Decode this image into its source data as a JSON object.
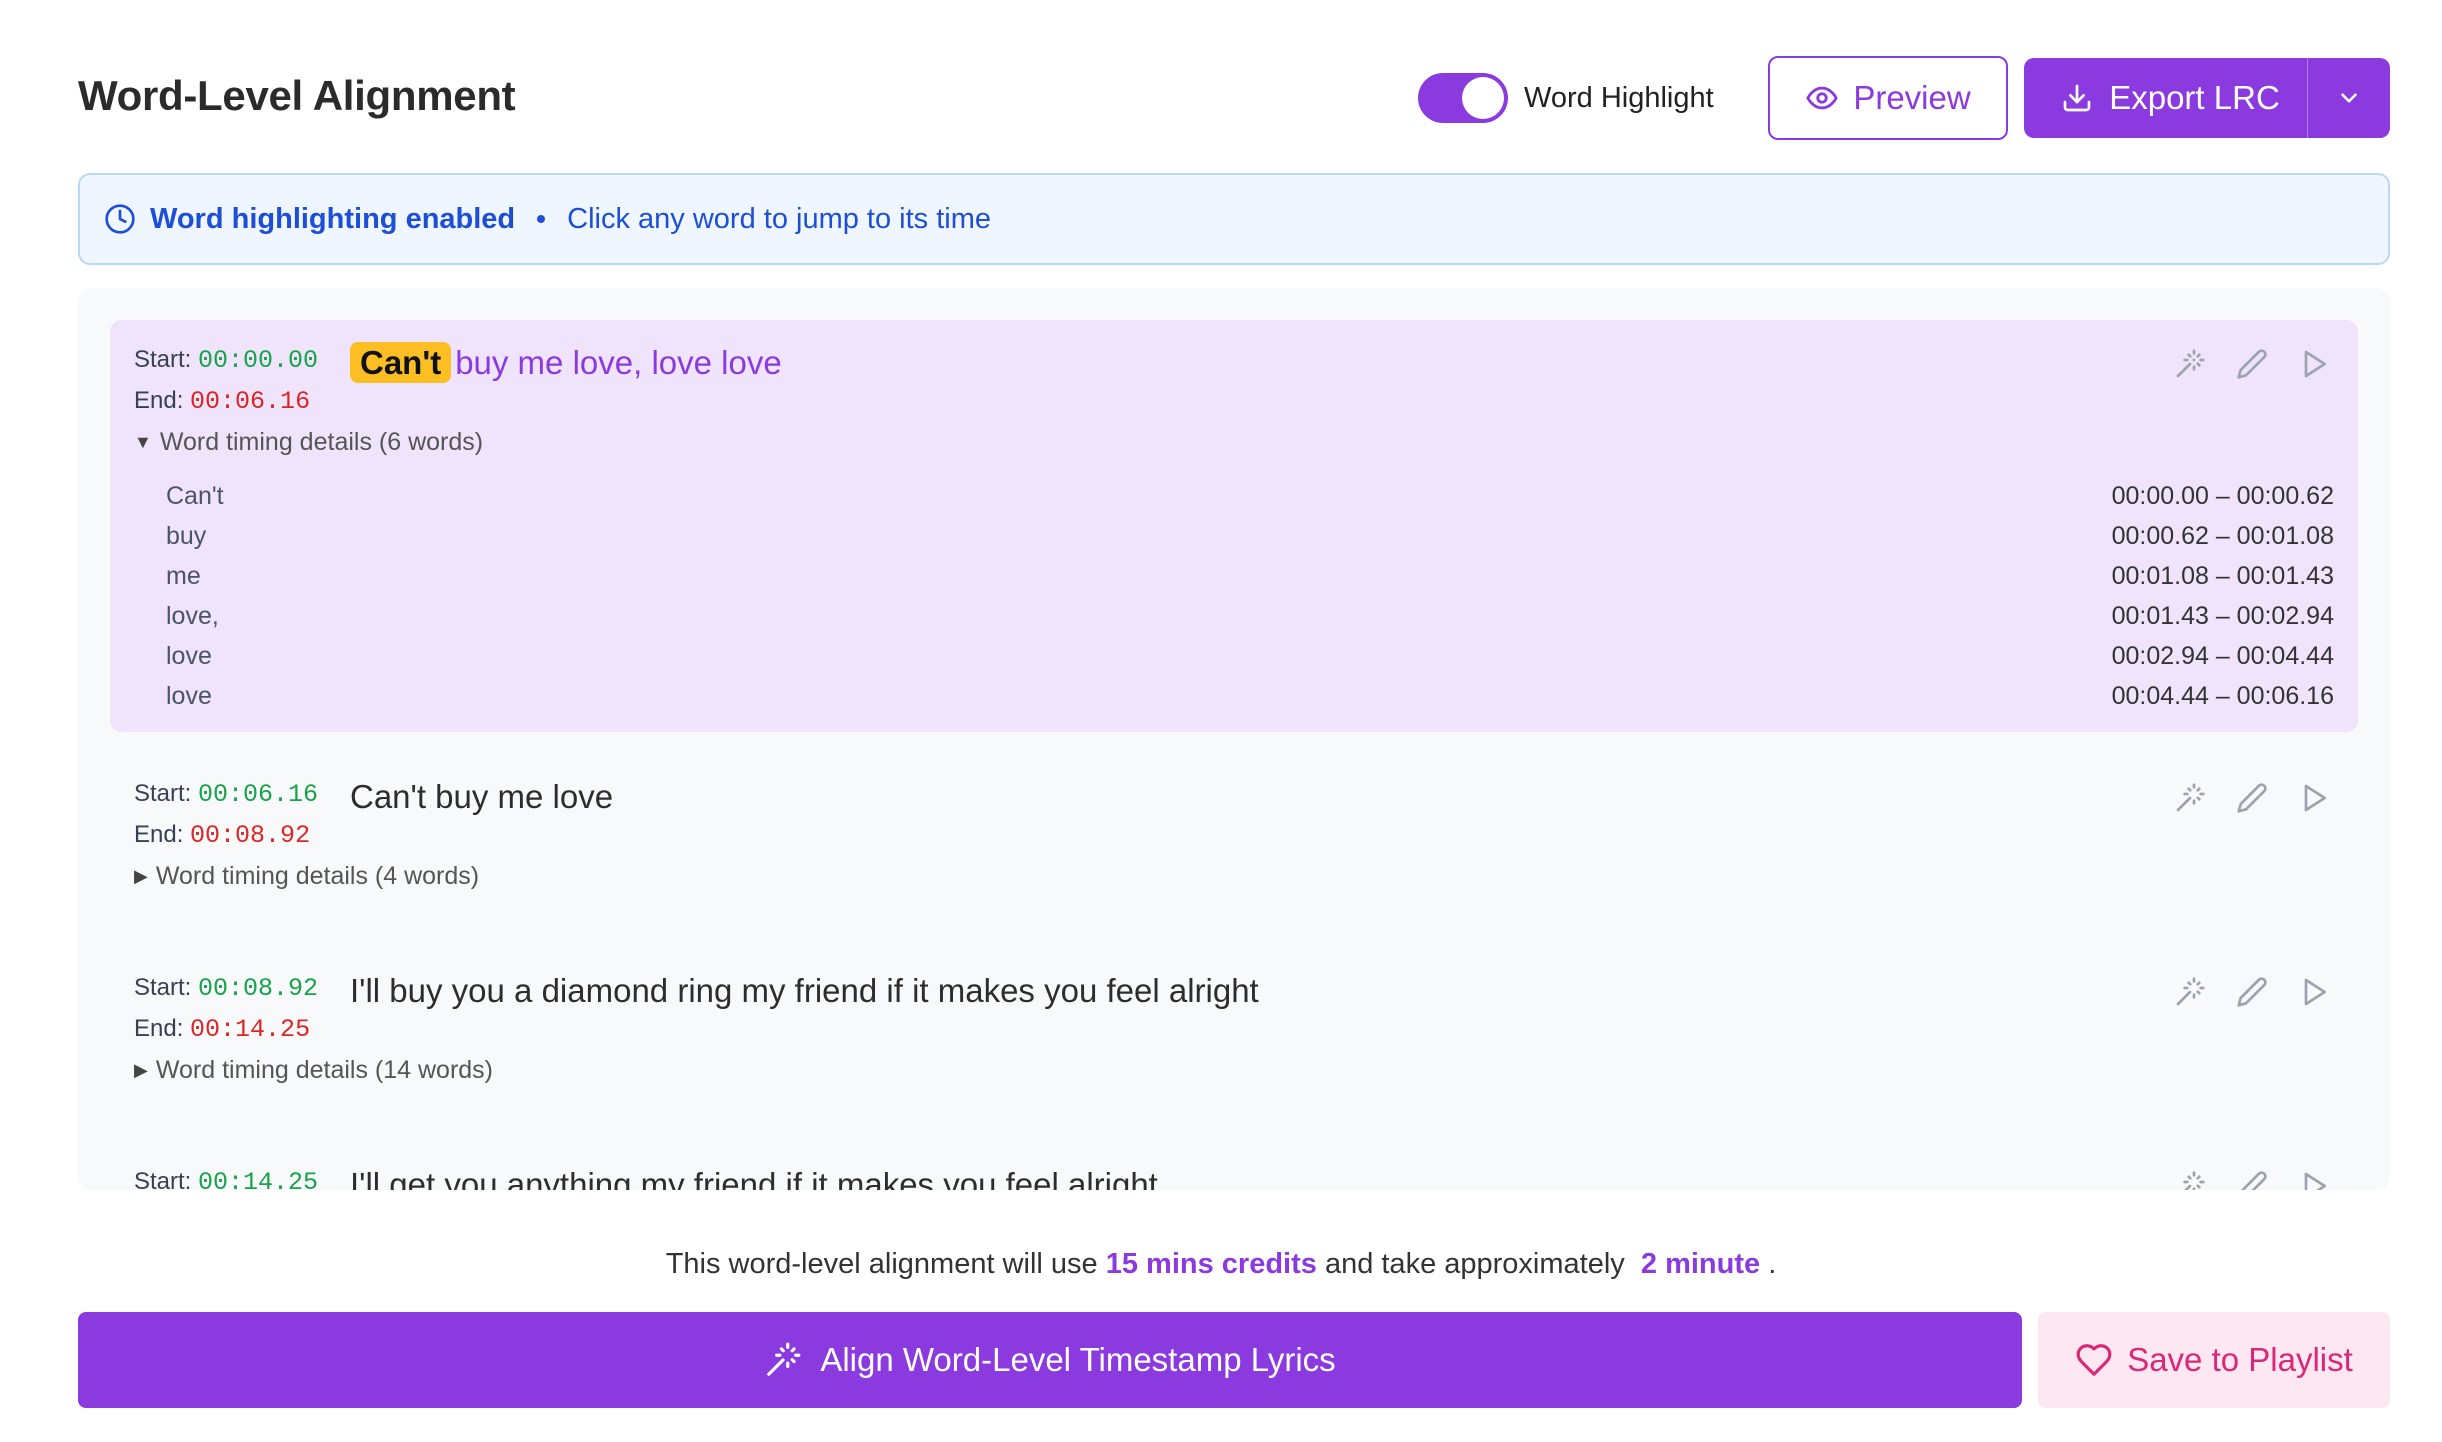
{
  "header": {
    "title": "Word-Level Alignment",
    "toggle_label": "Word Highlight",
    "toggle_on": true,
    "preview_label": "Preview",
    "export_label": "Export LRC"
  },
  "info_bar": {
    "strong_text": "Word highlighting enabled",
    "hint_text": "Click any word to jump to its time"
  },
  "labels": {
    "start": "Start:",
    "end": "End:"
  },
  "rows": [
    {
      "start": "00:00.00",
      "end": "00:06.16",
      "highlighted_word": "Can't",
      "rest": "buy me love, love love",
      "details_label": "Word timing details (6 words)",
      "expanded": true,
      "words": [
        {
          "word": "Can't",
          "range": "00:00.00 – 00:00.62"
        },
        {
          "word": "buy",
          "range": "00:00.62 – 00:01.08"
        },
        {
          "word": "me",
          "range": "00:01.08 – 00:01.43"
        },
        {
          "word": "love,",
          "range": "00:01.43 – 00:02.94"
        },
        {
          "word": "love",
          "range": "00:02.94 – 00:04.44"
        },
        {
          "word": "love",
          "range": "00:04.44 – 00:06.16"
        }
      ]
    },
    {
      "start": "00:06.16",
      "end": "00:08.92",
      "text": "Can't buy me love",
      "details_label": "Word timing details (4 words)",
      "expanded": false
    },
    {
      "start": "00:08.92",
      "end": "00:14.25",
      "text": "I'll buy you a diamond ring my friend if it makes you feel alright",
      "details_label": "Word timing details (14 words)",
      "expanded": false
    },
    {
      "start": "00:14.25",
      "text": "I'll get you anything my friend if it makes you feel alright"
    }
  ],
  "footer": {
    "credits_prefix": "This word-level alignment will use",
    "credits_amount": "15 mins credits",
    "credits_middle": "and take approximately",
    "credits_time": "2 minute",
    "credits_suffix": ".",
    "align_label": "Align Word-Level Timestamp Lyrics",
    "save_label": "Save to Playlist"
  },
  "colors": {
    "accent": "#8b3ae0",
    "start_time": "#16a34a",
    "end_time": "#dc2626",
    "highlight": "#fbbf24",
    "info_bg": "#eff6ff",
    "save_text": "#db2777"
  },
  "icons": [
    "eye-icon",
    "download-icon",
    "chevron-down-icon",
    "clock-icon",
    "magic-wand-icon",
    "pencil-icon",
    "play-icon",
    "heart-icon"
  ]
}
